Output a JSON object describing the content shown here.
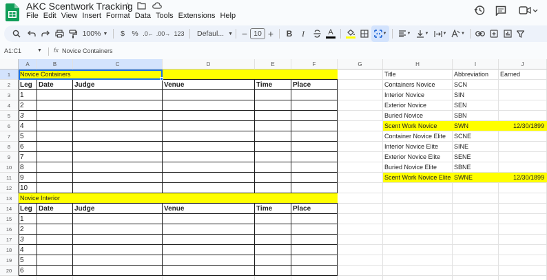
{
  "app": {
    "title": "AKC Scentwork Tracking",
    "menus": [
      "File",
      "Edit",
      "View",
      "Insert",
      "Format",
      "Data",
      "Tools",
      "Extensions",
      "Help"
    ]
  },
  "toolbar": {
    "zoom": "100%",
    "currency": "$",
    "percent": "%",
    "decrease_decimal": ".0",
    "increase_decimal": ".00",
    "number_format": "123",
    "font": "Defaul...",
    "font_size": "10",
    "minus": "−",
    "plus": "+",
    "bold": "B",
    "italic": "I",
    "text_color": "A"
  },
  "formula_bar": {
    "name_box": "A1:C1",
    "fx": "fx",
    "value": "Novice Containers"
  },
  "columns": [
    "A",
    "B",
    "C",
    "D",
    "E",
    "F",
    "G",
    "H",
    "I",
    "J"
  ],
  "rows": [
    "1",
    "2",
    "3",
    "4",
    "5",
    "6",
    "7",
    "8",
    "9",
    "10",
    "11",
    "12",
    "13",
    "14",
    "15",
    "16",
    "17",
    "18",
    "19",
    "20"
  ],
  "sections": [
    {
      "title": "Novice Containers",
      "headers": [
        "Leg",
        "Date",
        "Judge",
        "Venue",
        "Time",
        "Place"
      ],
      "legs": [
        "1",
        "2",
        "3",
        "4",
        "5",
        "6",
        "7",
        "8",
        "9",
        "10"
      ]
    },
    {
      "title": "Novice Interior",
      "headers": [
        "Leg",
        "Date",
        "Judge",
        "Venue",
        "Time",
        "Place"
      ],
      "legs": [
        "1",
        "2",
        "3",
        "4",
        "5",
        "6"
      ]
    }
  ],
  "titles_table": {
    "headers": [
      "Title",
      "Abbreviation",
      "Earned"
    ],
    "rows": [
      {
        "title": "Containers Novice",
        "abbr": "SCN",
        "earned": ""
      },
      {
        "title": "Interior Novice",
        "abbr": "SIN",
        "earned": ""
      },
      {
        "title": "Exterior Novice",
        "abbr": "SEN",
        "earned": ""
      },
      {
        "title": "Buried Novice",
        "abbr": "SBN",
        "earned": ""
      },
      {
        "title": "Scent Work Novice",
        "abbr": "SWN",
        "earned": "12/30/1899"
      },
      {
        "title": "Container Novice Elite",
        "abbr": "SCNE",
        "earned": ""
      },
      {
        "title": "Interior Novice Elite",
        "abbr": "SINE",
        "earned": ""
      },
      {
        "title": "Exterior Novice Elite",
        "abbr": "SENE",
        "earned": ""
      },
      {
        "title": "Buried Novice Elite",
        "abbr": "SBNE",
        "earned": ""
      },
      {
        "title": "Scent Work Novice Elite",
        "abbr": "SWNE",
        "earned": "12/30/1899"
      }
    ]
  },
  "colors": {
    "highlight": "#ffff00",
    "selection": "#1a73e8",
    "logo": "#0f9d58"
  }
}
